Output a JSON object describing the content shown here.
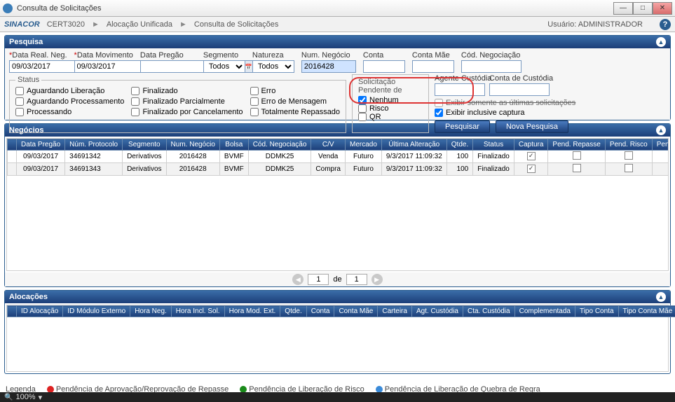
{
  "window": {
    "title": "Consulta de Solicitações"
  },
  "breadcrumb": {
    "logo": "SINACOR",
    "items": [
      "CERT3020",
      "Alocação Unificada",
      "Consulta de Solicitações"
    ],
    "user_label": "Usuário:",
    "user": "ADMINISTRADOR"
  },
  "panels": {
    "pesquisa": "Pesquisa",
    "negocios": "Negócios",
    "alocacoes": "Alocações"
  },
  "filters": {
    "data_real_neg_label": "Data Real. Neg.",
    "data_real_neg": "09/03/2017",
    "data_movimento_label": "Data Movimento",
    "data_movimento": "09/03/2017",
    "data_pregao_label": "Data Pregão",
    "data_pregao": "",
    "segmento_label": "Segmento",
    "segmento": "Todos",
    "natureza_label": "Natureza",
    "natureza": "Todos",
    "num_negocio_label": "Num. Negócio",
    "num_negocio": "2016428",
    "conta_label": "Conta",
    "conta": "",
    "conta_mae_label": "Conta Mãe",
    "conta_mae": "",
    "cod_negociacao_label": "Cód. Negociação",
    "cod_negociacao": "",
    "agente_custodia_label": "Agente Custódia",
    "agente_custodia": "",
    "conta_custodia_label": "Conta de Custódia",
    "conta_custodia": ""
  },
  "status": {
    "legend": "Status",
    "aguardando_liberacao": "Aguardando Liberação",
    "aguardando_processamento": "Aguardando Processamento",
    "processando": "Processando",
    "finalizado": "Finalizado",
    "finalizado_parcialmente": "Finalizado Parcialmente",
    "finalizado_por_cancelamento": "Finalizado por Cancelamento",
    "erro": "Erro",
    "erro_de_mensagem": "Erro de Mensagem",
    "totalmente_repassado": "Totalmente Repassado"
  },
  "pending": {
    "label": "Solicitação Pendente de",
    "nenhum": "Nenhum",
    "risco": "Risco",
    "qr": "QR"
  },
  "options": {
    "exibir_somente": "Exibir somente as últimas solicitações",
    "exibir_inclusive": "Exibir inclusive captura"
  },
  "buttons": {
    "pesquisar": "Pesquisar",
    "nova_pesquisa": "Nova Pesquisa"
  },
  "neg_headers": [
    "Data Pregão",
    "Núm. Protocolo",
    "Segmento",
    "Num. Negócio",
    "Bolsa",
    "Cód. Negociação",
    "C/V",
    "Mercado",
    "Última Alteração",
    "Qtde.",
    "Status",
    "Captura",
    "Pend. Repasse",
    "Pend. Risco",
    "Pend. Quebra Regra"
  ],
  "neg_rows": [
    {
      "data_pregao": "09/03/2017",
      "protocolo": "34691342",
      "segmento": "Derivativos",
      "num_negocio": "2016428",
      "bolsa": "BVMF",
      "cod": "DDMK25",
      "cv": "Venda",
      "mercado": "Futuro",
      "ultima": "9/3/2017 11:09:32",
      "qtde": "100",
      "status": "Finalizado",
      "captura": true
    },
    {
      "data_pregao": "09/03/2017",
      "protocolo": "34691343",
      "segmento": "Derivativos",
      "num_negocio": "2016428",
      "bolsa": "BVMF",
      "cod": "DDMK25",
      "cv": "Compra",
      "mercado": "Futuro",
      "ultima": "9/3/2017 11:09:32",
      "qtde": "100",
      "status": "Finalizado",
      "captura": true
    }
  ],
  "pager": {
    "page": "1",
    "de": "de",
    "total": "1"
  },
  "aloc_headers": [
    "ID Alocação",
    "ID Módulo Externo",
    "Hora Neg.",
    "Hora Incl. Sol.",
    "Hora Mod. Ext.",
    "Qtde.",
    "Conta",
    "Conta Mãe",
    "Carteira",
    "Agt. Custódia",
    "Cta. Custódia",
    "Complementada",
    "Tipo Conta",
    "Tipo Conta Mãe"
  ],
  "legend": {
    "label": "Legenda",
    "red": "Pendência de Aprovação/Reprovação de Repasse",
    "green": "Pendência de Liberação de Risco",
    "blue": "Pendência de Liberação de Quebra de Regra"
  },
  "statusbar": {
    "zoom": "100%"
  }
}
